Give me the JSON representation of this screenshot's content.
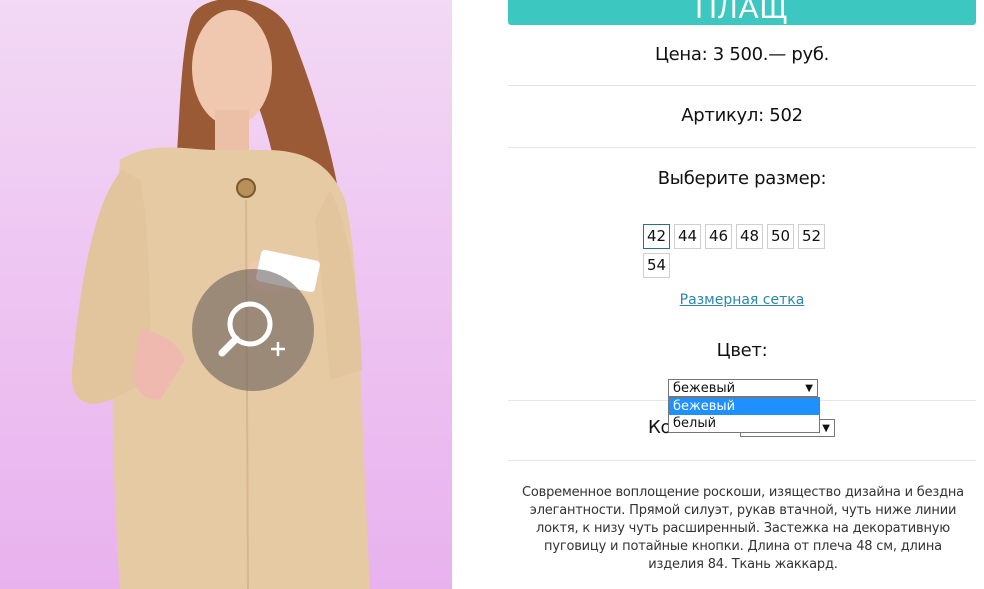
{
  "product": {
    "title": "ПЛАЩ",
    "price": "Цена: 3 500.— руб.",
    "article": "Артикул: 502",
    "size_heading": "Выберите размер:",
    "sizes": [
      "42",
      "44",
      "46",
      "48",
      "50",
      "52",
      "54"
    ],
    "selected_size": "42",
    "size_chart_link": "Размерная сетка",
    "color_heading": "Цвет:",
    "color_selected": "бежевый",
    "color_options": [
      "бежевый",
      "белый"
    ],
    "quantity_label_partial": "Ко",
    "description": "Современное воплощение роскоши, изящество дизайна и бездна элегантности. Прямой силуэт, рукав втачной, чуть ниже линии локтя, к низу чуть расширенный. Застежка на декоративную пуговицу и потайные кнопки. Длина от плеча 48 см, длина изделия 84. Ткань жаккард."
  },
  "colors": {
    "accent": "#3cc8c0",
    "link": "#2a88a8",
    "dropdown_highlight": "#1e90ff"
  },
  "icons": {
    "zoom": "zoom-in-icon",
    "dropdown_arrow": "triangle-down-icon"
  }
}
